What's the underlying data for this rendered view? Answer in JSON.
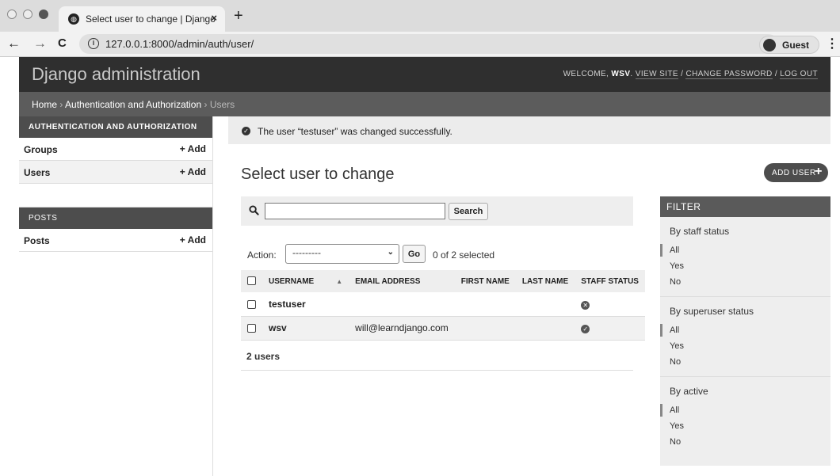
{
  "browser": {
    "tab_title": "Select user to change | Django",
    "tab_close": "×",
    "new_tab": "+",
    "nav_back": "←",
    "nav_forward": "→",
    "nav_reload": "C",
    "url": "127.0.0.1:8000/admin/auth/user/",
    "profile_label": "Guest",
    "menu": "⋮"
  },
  "header": {
    "branding": "Django administration",
    "welcome": "WELCOME, ",
    "username": "WSV",
    "view_site": "VIEW SITE",
    "change_password": "CHANGE PASSWORD",
    "log_out": "LOG OUT"
  },
  "breadcrumbs": {
    "home": "Home",
    "app": "Authentication and Authorization",
    "current": "Users"
  },
  "sidebar": {
    "modules": [
      {
        "caption": "Authentication and Authorization",
        "models": [
          {
            "name": "Groups",
            "add": "Add"
          },
          {
            "name": "Users",
            "add": "Add"
          }
        ]
      },
      {
        "caption": "Posts",
        "models": [
          {
            "name": "Posts",
            "add": "Add"
          }
        ]
      }
    ]
  },
  "message": {
    "text": "The user “testuser” was changed successfully."
  },
  "content": {
    "title": "Select user to change",
    "add_button": "ADD USER"
  },
  "search": {
    "value": "",
    "button": "Search"
  },
  "actions": {
    "label": "Action:",
    "selected_option": "---------",
    "go_button": "Go",
    "counter": "0 of 2 selected"
  },
  "table": {
    "columns": [
      "USERNAME",
      "EMAIL ADDRESS",
      "FIRST NAME",
      "LAST NAME",
      "STAFF STATUS"
    ],
    "rows": [
      {
        "username": "testuser",
        "email": "",
        "first_name": "",
        "last_name": "",
        "staff_status": "no"
      },
      {
        "username": "wsv",
        "email": "will@learndjango.com",
        "first_name": "",
        "last_name": "",
        "staff_status": "yes"
      }
    ]
  },
  "paginator": {
    "text": "2 users"
  },
  "filter": {
    "title": "FILTER",
    "groups": [
      {
        "heading": "By staff status",
        "options": [
          "All",
          "Yes",
          "No"
        ],
        "selected": "All"
      },
      {
        "heading": "By superuser status",
        "options": [
          "All",
          "Yes",
          "No"
        ],
        "selected": "All"
      },
      {
        "heading": "By active",
        "options": [
          "All",
          "Yes",
          "No"
        ],
        "selected": "All"
      }
    ]
  },
  "icons": {
    "favicon": "globe-icon",
    "info": "info-icon",
    "profile": "person-icon",
    "success": "checkmark-circle-icon",
    "search": "magnifier-icon",
    "staff_no": "x-circle-icon",
    "staff_yes": "check-circle-icon"
  }
}
